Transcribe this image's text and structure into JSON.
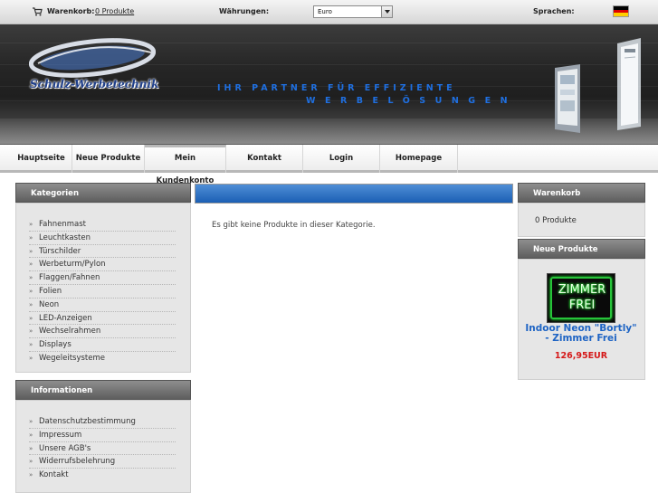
{
  "topbar": {
    "cart_label": "Warenkorb:",
    "cart_value": "0 Produkte",
    "currency_label": "Währungen:",
    "currency_selected": "Euro",
    "language_label": "Sprachen:"
  },
  "header": {
    "logo_text": "Schulz-Werbetechnik",
    "slogan_line1": "IHR PARTNER FÜR EFFIZIENTE",
    "slogan_line2": "WERBELÖSUNGEN"
  },
  "nav": {
    "items": [
      {
        "label": "Hauptseite"
      },
      {
        "label": "Neue Produkte"
      },
      {
        "label": "Mein Kundenkonto"
      },
      {
        "label": "Kontakt"
      },
      {
        "label": "Login"
      },
      {
        "label": "Homepage"
      }
    ]
  },
  "categories": {
    "title": "Kategorien",
    "items": [
      {
        "label": "Fahnenmast"
      },
      {
        "label": "Leuchtkasten"
      },
      {
        "label": "Türschilder"
      },
      {
        "label": "Werbeturm/Pylon"
      },
      {
        "label": "Flaggen/Fahnen"
      },
      {
        "label": "Folien"
      },
      {
        "label": "Neon"
      },
      {
        "label": "LED-Anzeigen"
      },
      {
        "label": "Wechselrahmen"
      },
      {
        "label": "Displays"
      },
      {
        "label": "Wegeleitsysteme"
      }
    ]
  },
  "information": {
    "title": "Informationen",
    "items": [
      {
        "label": "Datenschutzbestimmung"
      },
      {
        "label": "Impressum"
      },
      {
        "label": "Unsere AGB's"
      },
      {
        "label": "Widerrufsbelehrung"
      },
      {
        "label": "Kontakt"
      }
    ]
  },
  "main": {
    "message": "Es gibt keine Produkte in dieser Kategorie."
  },
  "cart_box": {
    "title": "Warenkorb",
    "count": "0 Produkte"
  },
  "new_products": {
    "title": "Neue Produkte",
    "product": {
      "image_text_line1": "ZIMMER",
      "image_text_line2": "FREI",
      "name": "Indoor Neon \"Bortly\" - Zimmer Frei",
      "price": "126,95EUR"
    }
  },
  "colors": {
    "accent_blue": "#1e64c4",
    "price_red": "#d51818",
    "box_header_gray": "#6e6e6e"
  }
}
